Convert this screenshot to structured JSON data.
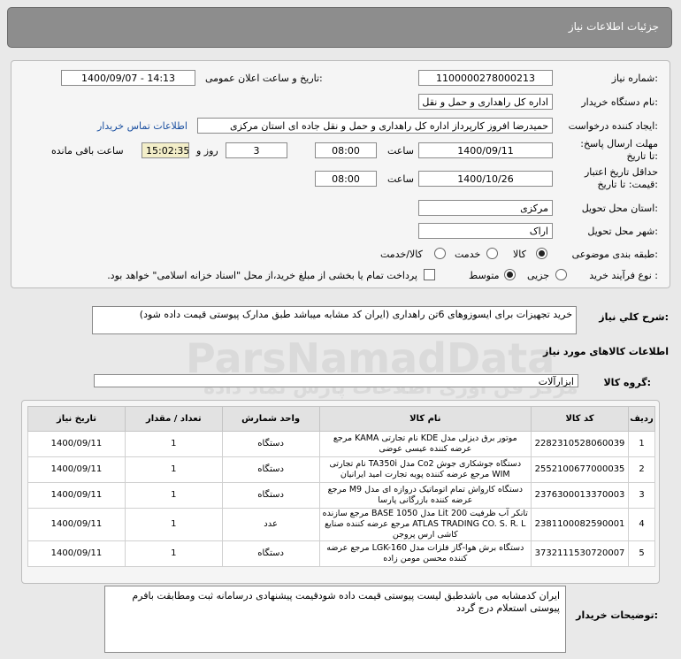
{
  "header": {
    "title": "جزئیات اطلاعات نیاز"
  },
  "fields": {
    "need_number": {
      "label": "شماره نیاز:",
      "value": "1100000278000213"
    },
    "announce_datetime": {
      "label": "تاریخ و ساعت اعلان عمومی:",
      "value": "1400/09/07 - 14:13"
    },
    "buyer_org": {
      "label": "نام دستگاه خریدار:",
      "value": "اداره کل راهداری و حمل و نقل جاده ای استان مرکزی"
    },
    "requester": {
      "label": "ایجاد کننده درخواست:",
      "value": "حمیدرضا  افروز  کارپرداز اداره کل راهداری و حمل و نقل جاده ای استان مرکزی",
      "contact_link": "اطلاعات تماس خریدار"
    },
    "reply_deadline": {
      "label": "مهلت ارسال پاسخ: تا تاریخ:",
      "date": "1400/09/11",
      "time_label": "ساعت",
      "time": "08:00",
      "days": "3",
      "days_label": "روز و",
      "remaining": "15:02:35",
      "remaining_label": "ساعت باقی مانده"
    },
    "price_validity": {
      "label": "حداقل تاریخ اعتبار قیمت: تا تاریخ:",
      "date": "1400/10/26",
      "time_label": "ساعت",
      "time": "08:00"
    },
    "delivery_province": {
      "label": "استان محل تحویل:",
      "value": "مرکزی"
    },
    "delivery_city": {
      "label": "شهر محل تحویل:",
      "value": "اراک"
    },
    "category": {
      "label": "طبقه بندی موضوعی:",
      "options": [
        "کالا",
        "خدمت",
        "کالا/خدمت"
      ],
      "selected": "کالا"
    },
    "purchase_process": {
      "label": "نوع فرآیند خرید :",
      "options": [
        "جزیی",
        "متوسط"
      ],
      "selected": "متوسط",
      "payment_note": "پرداخت تمام یا بخشی از مبلغ خرید،از محل \"اسناد خزانه اسلامی\" خواهد بود."
    }
  },
  "description": {
    "label": "شرح کلي نياز:",
    "value": "خرید تجهیزات برای ایسوزوهای 6تن راهداری (ایران کد مشابه میباشد  طبق مدارک پیوستی قیمت داده شود)"
  },
  "goods_info": {
    "title": "اطلاعات کالاهای مورد نیاز",
    "group_label": "گروه کالا:",
    "group_value": "ابزارآلات"
  },
  "table": {
    "headers": [
      "ردیف",
      "کد کالا",
      "نام کالا",
      "واحد شمارش",
      "تعداد / مقدار",
      "تاریخ نیاز"
    ],
    "rows": [
      {
        "row": "1",
        "code": "2282310528060039",
        "name": "موتور برق دیزلی مدل KDE نام تجارتی KAMA مرجع عرضه کننده عیسی عوضی",
        "unit": "دستگاه",
        "qty": "1",
        "date": "1400/09/11"
      },
      {
        "row": "2",
        "code": "2552100677000035",
        "name": "دستگاه جوشکاری جوش Co2 مدل TA350i نام تجارتی WIM مرجع عرضه کننده پویه تجارت امید ایرانیان",
        "unit": "دستگاه",
        "qty": "1",
        "date": "1400/09/11"
      },
      {
        "row": "3",
        "code": "2376300013370003",
        "name": "دستگاه کارواش تمام اتوماتیک دروازه ای مدل M9 مرجع عرضه کننده بازرگانی پارسا",
        "unit": "دستگاه",
        "qty": "1",
        "date": "1400/09/11"
      },
      {
        "row": "4",
        "code": "2381100082590001",
        "name": "تانکر آب ظرفیت 200 Lit مدل BASE 1050 مرجع سازنده ATLAS TRADING CO. S. R. L مرجع عرضه کننده صنایع کاشی ارس پروجن",
        "unit": "عدد",
        "qty": "1",
        "date": "1400/09/11"
      },
      {
        "row": "5",
        "code": "3732111530720007",
        "name": "دستگاه برش هوا-گاز فلزات مدل LGK-160 مرجع عرضه کننده محسن مومن زاده",
        "unit": "دستگاه",
        "qty": "1",
        "date": "1400/09/11"
      }
    ]
  },
  "buyer_notes": {
    "label": "توضیحات خریدار:",
    "value": "ایران کدمشابه می باشدطبق لیست پیوستی قیمت داده شودقیمت پیشنهادی درسامانه ثبت ومطابقت بافرم پیوستی استعلام درج گردد"
  },
  "watermark": {
    "brand": "ParsNamadData",
    "tagline": "مرکز فن آوری اطلاعات پارس نماد داده"
  }
}
